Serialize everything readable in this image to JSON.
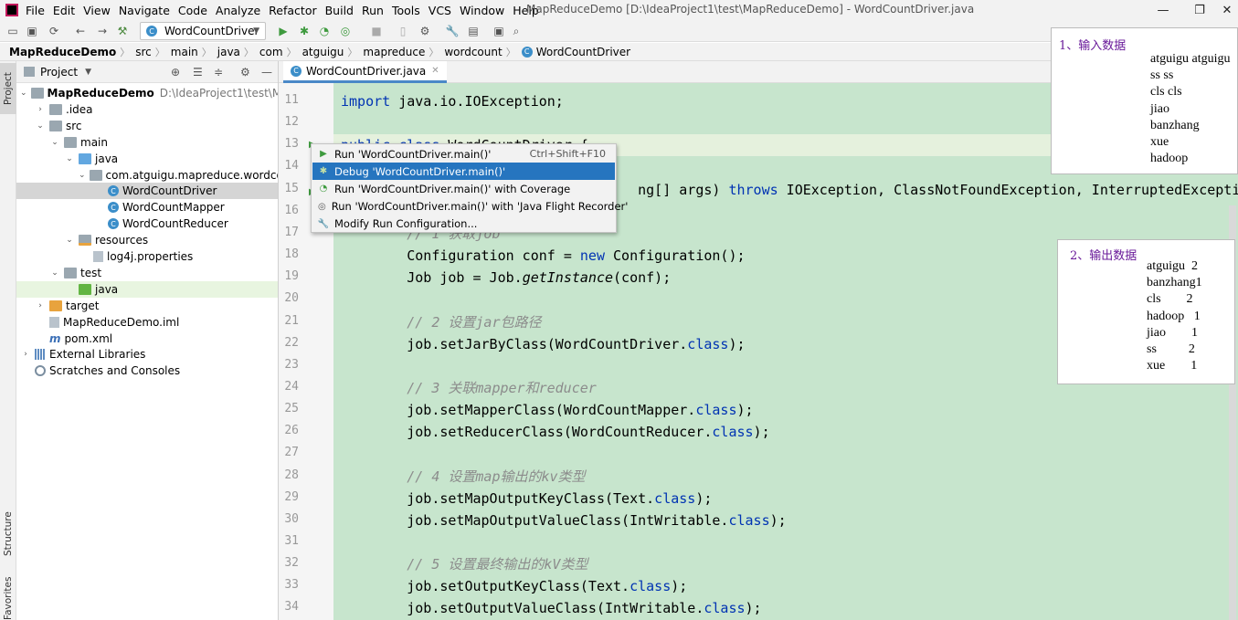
{
  "menubar": {
    "items": [
      "File",
      "Edit",
      "View",
      "Navigate",
      "Code",
      "Analyze",
      "Refactor",
      "Build",
      "Run",
      "Tools",
      "VCS",
      "Window",
      "Help"
    ],
    "window_title": "MapReduceDemo [D:\\IdeaProject1\\test\\MapReduceDemo] - WordCountDriver.java"
  },
  "toolbar": {
    "run_config": "WordCountDriver"
  },
  "breadcrumb": [
    "MapReduceDemo",
    "src",
    "main",
    "java",
    "com",
    "atguigu",
    "mapreduce",
    "wordcount",
    "WordCountDriver"
  ],
  "left_strip": {
    "project": "Project",
    "structure": "Structure",
    "favorites": "Favorites"
  },
  "project_panel": {
    "title": "Project",
    "tree": [
      {
        "label": "MapReduceDemo",
        "path": "D:\\IdeaProject1\\test\\MapRe",
        "depth": 0,
        "arrow": "down",
        "icon": "folder"
      },
      {
        "label": ".idea",
        "depth": 1,
        "arrow": "right",
        "icon": "folder"
      },
      {
        "label": "src",
        "depth": 1,
        "arrow": "down",
        "icon": "folder"
      },
      {
        "label": "main",
        "depth": 2,
        "arrow": "down",
        "icon": "folder"
      },
      {
        "label": "java",
        "depth": 3,
        "arrow": "down",
        "icon": "folder-src"
      },
      {
        "label": "com.atguigu.mapreduce.wordcoun",
        "depth": 4,
        "arrow": "down",
        "icon": "folder"
      },
      {
        "label": "WordCountDriver",
        "depth": 5,
        "arrow": "",
        "icon": "class",
        "selected": true
      },
      {
        "label": "WordCountMapper",
        "depth": 5,
        "arrow": "",
        "icon": "class"
      },
      {
        "label": "WordCountReducer",
        "depth": 5,
        "arrow": "",
        "icon": "class"
      },
      {
        "label": "resources",
        "depth": 3,
        "arrow": "down",
        "icon": "folder-res"
      },
      {
        "label": "log4j.properties",
        "depth": 4,
        "arrow": "",
        "icon": "file"
      },
      {
        "label": "test",
        "depth": 2,
        "arrow": "down",
        "icon": "folder"
      },
      {
        "label": "java",
        "depth": 3,
        "arrow": "",
        "icon": "folder-test",
        "highlight": true
      },
      {
        "label": "target",
        "depth": 1,
        "arrow": "right",
        "icon": "folder-target"
      },
      {
        "label": "MapReduceDemo.iml",
        "depth": 1,
        "arrow": "",
        "icon": "file"
      },
      {
        "label": "pom.xml",
        "depth": 1,
        "arrow": "",
        "icon": "maven",
        "prefix": "m"
      },
      {
        "label": "External Libraries",
        "depth": 0,
        "arrow": "right",
        "icon": "lib"
      },
      {
        "label": "Scratches and Consoles",
        "depth": 0,
        "arrow": "",
        "icon": "scratch"
      }
    ]
  },
  "editor": {
    "tab": "WordCountDriver.java",
    "lines": [
      {
        "n": "11",
        "html": "<span class=\"kw\">import</span> java.io.IOException;"
      },
      {
        "n": "12",
        "html": ""
      },
      {
        "n": "13",
        "html": "<span class=\"kw\">public class</span> WordCountDriver {"
      },
      {
        "n": "14",
        "html": ""
      },
      {
        "n": "15",
        "html": "                                    ng[] args) <span class=\"kw\">throws</span> IOException, ClassNotFoundException, InterruptedExceptio"
      },
      {
        "n": "16",
        "html": ""
      },
      {
        "n": "17",
        "html": "        <span class=\"cm\">// 1 获取job</span>"
      },
      {
        "n": "18",
        "html": "        Configuration conf = <span class=\"kw\">new</span> Configuration();"
      },
      {
        "n": "19",
        "html": "        Job job = Job.<span class=\"it\">getInstance</span>(conf);"
      },
      {
        "n": "20",
        "html": ""
      },
      {
        "n": "21",
        "html": "        <span class=\"cm\">// 2 设置jar包路径</span>"
      },
      {
        "n": "22",
        "html": "        job.setJarByClass(WordCountDriver.<span class=\"kw\">class</span>);"
      },
      {
        "n": "23",
        "html": ""
      },
      {
        "n": "24",
        "html": "        <span class=\"cm\">// 3 关联mapper和reducer</span>"
      },
      {
        "n": "25",
        "html": "        job.setMapperClass(WordCountMapper.<span class=\"kw\">class</span>);"
      },
      {
        "n": "26",
        "html": "        job.setReducerClass(WordCountReducer.<span class=\"kw\">class</span>);"
      },
      {
        "n": "27",
        "html": ""
      },
      {
        "n": "28",
        "html": "        <span class=\"cm\">// 4 设置map输出的kv类型</span>"
      },
      {
        "n": "29",
        "html": "        job.setMapOutputKeyClass(Text.<span class=\"kw\">class</span>);"
      },
      {
        "n": "30",
        "html": "        job.setMapOutputValueClass(IntWritable.<span class=\"kw\">class</span>);"
      },
      {
        "n": "31",
        "html": ""
      },
      {
        "n": "32",
        "html": "        <span class=\"cm\">// 5 设置最终输出的kV类型</span>"
      },
      {
        "n": "33",
        "html": "        job.setOutputKeyClass(Text.<span class=\"kw\">class</span>);"
      },
      {
        "n": "34",
        "html": "        job.setOutputValueClass(IntWritable.<span class=\"kw\">class</span>);"
      }
    ]
  },
  "context_menu": {
    "items": [
      {
        "label": "Run 'WordCountDriver.main()'",
        "shortcut": "Ctrl+Shift+F10",
        "icon": "run-icon"
      },
      {
        "label": "Debug 'WordCountDriver.main()'",
        "shortcut": "",
        "icon": "debug-icon",
        "active": true
      },
      {
        "label": "Run 'WordCountDriver.main()' with Coverage",
        "shortcut": "",
        "icon": "coverage-icon"
      },
      {
        "label": "Run 'WordCountDriver.main()' with 'Java Flight Recorder'",
        "shortcut": "",
        "icon": "profiler-icon"
      },
      {
        "label": "Modify Run Configuration...",
        "shortcut": "",
        "icon": "wrench-icon"
      }
    ]
  },
  "note_input": {
    "title": "1、输入数据",
    "lines": [
      "atguigu atguigu",
      "ss ss",
      "cls cls",
      "jiao",
      "banzhang",
      "xue",
      "hadoop"
    ]
  },
  "note_output": {
    "title": "2、输出数据",
    "lines": [
      "atguigu  2",
      "banzhang1",
      "cls        2",
      "hadoop   1",
      "jiao        1",
      "ss          2",
      "xue        1"
    ]
  }
}
